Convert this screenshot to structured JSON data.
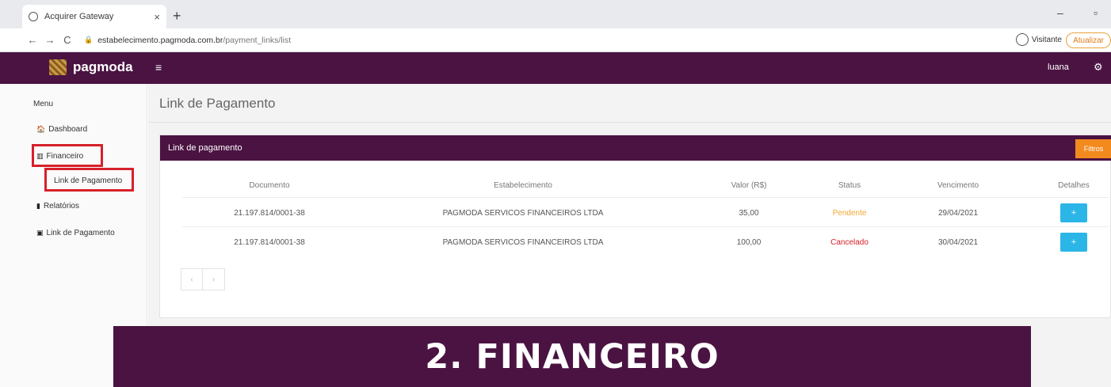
{
  "browser": {
    "tab_title": "Acquirer Gateway",
    "tab_close": "×",
    "new_tab": "+",
    "url_host": "estabelecimento.pagmoda.com.br",
    "url_path": "/payment_links/list",
    "profile_label": "Visitante",
    "update_label": "Atualizar",
    "minimize": "–",
    "maximize": "▫"
  },
  "app": {
    "logo_text": "pagmoda",
    "menu_toggle": "≡",
    "user_name": "luana",
    "gear": "⚙"
  },
  "sidebar": {
    "title": "Menu",
    "items": [
      {
        "icon": "🏠",
        "label": "Dashboard"
      },
      {
        "icon": "▥",
        "label": "Financeiro"
      },
      {
        "icon": "",
        "label": "Link de Pagamento"
      },
      {
        "icon": "▮",
        "label": "Relatórios"
      },
      {
        "icon": "▣",
        "label": "Link de Pagamento"
      }
    ]
  },
  "main": {
    "page_title": "Link de Pagamento",
    "card_title": "Link de pagamento",
    "filter_label": "Filtros",
    "columns": [
      "Documento",
      "Estabelecimento",
      "Valor (R$)",
      "Status",
      "Vencimento",
      "Detalhes"
    ],
    "rows": [
      {
        "documento": "21.197.814/0001-38",
        "estabelecimento": "PAGMODA SERVICOS FINANCEIROS LTDA",
        "valor": "35,00",
        "status": "Pendente",
        "vencimento": "29/04/2021",
        "detalhes": "+"
      },
      {
        "documento": "21.197.814/0001-38",
        "estabelecimento": "PAGMODA SERVICOS FINANCEIROS LTDA",
        "valor": "100,00",
        "status": "Cancelado",
        "vencimento": "30/04/2021",
        "detalhes": "+"
      }
    ],
    "pager": [
      "‹",
      "›"
    ]
  },
  "banner": {
    "text": "2. FINANCEIRO"
  },
  "colors": {
    "brand_purple": "#4a1342",
    "filter_orange": "#f28a1e",
    "action_blue": "#2bb6e7",
    "status_pending": "#f0a830",
    "status_cancelled": "#d6202a",
    "highlight_red": "#d6202a"
  }
}
